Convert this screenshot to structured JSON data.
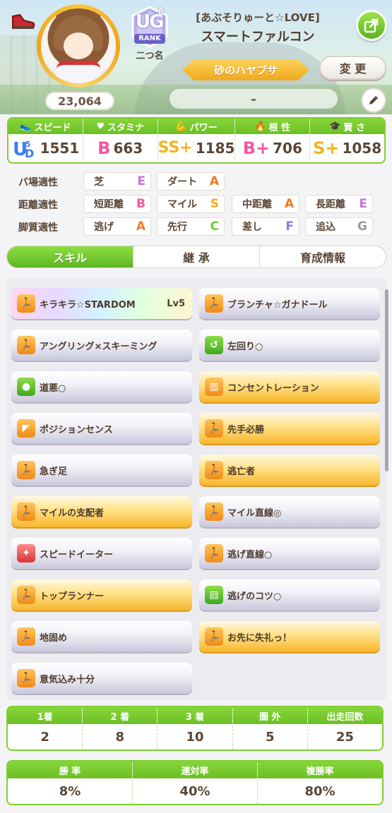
{
  "header": {
    "score": "23,064",
    "rank": {
      "tier": "8",
      "code": "UG",
      "label": "RANK",
      "subtitle": "二つ名"
    },
    "epithet": "[あぶそりゅーと☆LOVE]",
    "chara_name": "スマートファルコン",
    "title": "砂のハヤブサ",
    "change_label": "変 更",
    "memo": "–"
  },
  "stats": [
    {
      "label": "スピード",
      "grade": "UD",
      "grade_num": "5",
      "value": "1551",
      "icon": "shoe-icon",
      "color": "#3d7cf0"
    },
    {
      "label": "スタミナ",
      "grade": "B",
      "value": "663",
      "icon": "heart-icon",
      "color": "#f0589f"
    },
    {
      "label": "パワー",
      "grade": "SS+",
      "value": "1185",
      "icon": "muscle-icon",
      "color": "#f5b31c"
    },
    {
      "label": "根 性",
      "grade": "B+",
      "value": "706",
      "icon": "flame-icon",
      "color": "#f0589f"
    },
    {
      "label": "賢 さ",
      "grade": "S+",
      "value": "1058",
      "icon": "graduation-cap-icon",
      "color": "#f5b31c"
    }
  ],
  "aptitude": {
    "track": {
      "label": "バ場適性",
      "items": [
        {
          "name": "芝",
          "grade": "E"
        },
        {
          "name": "ダート",
          "grade": "A"
        }
      ]
    },
    "distance": {
      "label": "距離適性",
      "items": [
        {
          "name": "短距離",
          "grade": "B"
        },
        {
          "name": "マイル",
          "grade": "S"
        },
        {
          "name": "中距離",
          "grade": "A"
        },
        {
          "name": "長距離",
          "grade": "E"
        }
      ]
    },
    "style": {
      "label": "脚質適性",
      "items": [
        {
          "name": "逃げ",
          "grade": "A"
        },
        {
          "name": "先行",
          "grade": "C"
        },
        {
          "name": "差し",
          "grade": "F"
        },
        {
          "name": "追込",
          "grade": "G"
        }
      ]
    }
  },
  "grade_colors": {
    "S": "#f5a81c",
    "A": "#f07a22",
    "B": "#f0589f",
    "C": "#6ac62a",
    "E": "#c86fdc",
    "F": "#7b7ee8",
    "G": "#9a9a9a"
  },
  "tabs": [
    {
      "label": "スキル",
      "active": true
    },
    {
      "label": "継 承",
      "active": false
    },
    {
      "label": "育成情報",
      "active": false
    }
  ],
  "skills": [
    {
      "name": "キラキラ☆STARDOM",
      "level": "Lv5",
      "style": "rainbow",
      "icon": "runner-icon",
      "icon_color": "orange"
    },
    {
      "name": "ブランチャ☆ガナドール",
      "style": "normal",
      "icon": "runner-icon",
      "icon_color": "orange"
    },
    {
      "name": "アングリング×スキーミング",
      "style": "normal",
      "icon": "runner-icon",
      "icon_color": "orange"
    },
    {
      "name": "左回り○",
      "style": "normal",
      "icon": "turn-icon",
      "icon_color": "green"
    },
    {
      "name": "道悪○",
      "style": "normal",
      "icon": "mud-icon",
      "icon_color": "green"
    },
    {
      "name": "コンセントレーション",
      "style": "gold",
      "icon": "gate-icon",
      "icon_color": "orange"
    },
    {
      "name": "ポジションセンス",
      "style": "normal",
      "icon": "position-icon",
      "icon_color": "orange"
    },
    {
      "name": "先手必勝",
      "style": "gold",
      "icon": "runner-icon",
      "icon_color": "orange"
    },
    {
      "name": "急ぎ足",
      "style": "normal",
      "icon": "runner-icon",
      "icon_color": "orange"
    },
    {
      "name": "逃亡者",
      "style": "gold",
      "icon": "runner-icon",
      "icon_color": "orange"
    },
    {
      "name": "マイルの支配者",
      "style": "gold",
      "icon": "runner-icon",
      "icon_color": "orange"
    },
    {
      "name": "マイル直線◎",
      "style": "normal",
      "icon": "runner-icon",
      "icon_color": "orange"
    },
    {
      "name": "スピードイーター",
      "style": "normal",
      "icon": "eater-icon",
      "icon_color": "red"
    },
    {
      "name": "逃げ直線○",
      "style": "normal",
      "icon": "runner-icon",
      "icon_color": "orange"
    },
    {
      "name": "トップランナー",
      "style": "gold",
      "icon": "runner-icon",
      "icon_color": "orange"
    },
    {
      "name": "逃げのコツ○",
      "style": "normal",
      "icon": "notebook-icon",
      "icon_color": "green"
    },
    {
      "name": "地固め",
      "style": "normal",
      "icon": "runner-icon",
      "icon_color": "orange"
    },
    {
      "name": "お先に失礼っ！",
      "style": "gold",
      "icon": "runner-icon",
      "icon_color": "orange"
    },
    {
      "name": "意気込み十分",
      "style": "normal",
      "icon": "runner-icon",
      "icon_color": "orange"
    }
  ],
  "results": [
    {
      "label": "1着",
      "value": "2"
    },
    {
      "label": "2 着",
      "value": "8"
    },
    {
      "label": "3 着",
      "value": "10"
    },
    {
      "label": "圏 外",
      "value": "5"
    },
    {
      "label": "出走回数",
      "value": "25"
    }
  ],
  "rates": [
    {
      "label": "勝 率",
      "value": "8%"
    },
    {
      "label": "連対率",
      "value": "40%"
    },
    {
      "label": "複勝率",
      "value": "80%"
    }
  ]
}
